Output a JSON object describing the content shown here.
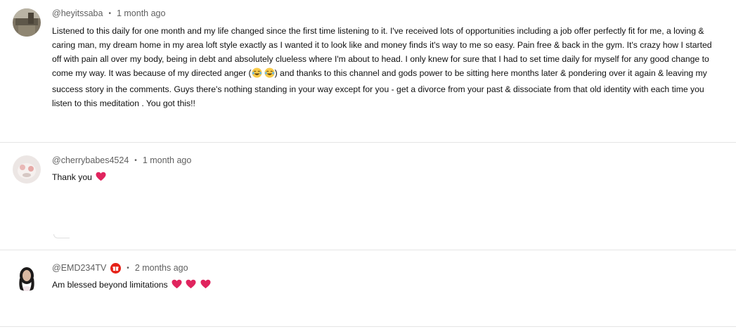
{
  "comments": [
    {
      "handle": "@heyitssaba",
      "separator": "•",
      "time": "1 month ago",
      "text_before_emoji": "Listened to this daily for one month and my life changed since the first time listening to it. I've received lots of opportunities including a job offer perfectly fit for me, a loving & caring man, my dream home in my area loft style exactly as I wanted it to look like and money finds it's way to me so easy. Pain free & back in the gym. It's crazy how I started off with pain all over my body, being in debt and absolutely clueless where I'm about to head. I only knew for sure that I had to set time daily for myself for any good change to come my way. It was because of my directed anger (",
      "text_after_emoji": ") and thanks to this channel and gods power to be sitting here months later & pondering over it again & leaving my success story in the comments. Guys there's nothing standing in your way except for you - get a divorce from your past & dissociate from that old identity with each time you listen to this meditation . You got this!!",
      "emoji": "laughing-tears-icon"
    },
    {
      "handle": "@cherrybabes4524",
      "separator": "•",
      "time": "1 month ago",
      "text": "Thank you",
      "emoji": "red-heart-icon"
    },
    {
      "handle": "@EMD234TV",
      "separator": "•",
      "time": "2 months ago",
      "text": "Am blessed beyond limitations",
      "emoji": "red-heart-icon",
      "badge_icon": "gift-badge-icon"
    }
  ],
  "colors": {
    "heart": "#e0245e",
    "badge": "#e62117",
    "meta_text": "#606060",
    "body_text": "#0f0f0f",
    "divider": "#e5e5e5"
  }
}
